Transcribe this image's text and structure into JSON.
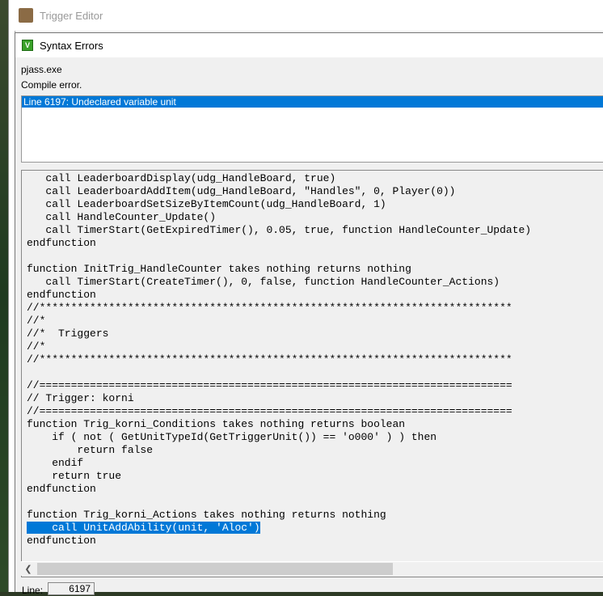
{
  "parent_window": {
    "title": "Trigger Editor"
  },
  "dialog": {
    "title": "Syntax Errors",
    "tool": "pjass.exe",
    "status": "Compile error.",
    "errors": [
      "Line 6197:  Undeclared variable unit"
    ],
    "selected_error": 0,
    "code_lines": [
      "   call LeaderboardDisplay(udg_HandleBoard, true)",
      "   call LeaderboardAddItem(udg_HandleBoard, \"Handles\", 0, Player(0))",
      "   call LeaderboardSetSizeByItemCount(udg_HandleBoard, 1)",
      "   call HandleCounter_Update()",
      "   call TimerStart(GetExpiredTimer(), 0.05, true, function HandleCounter_Update)",
      "endfunction",
      "",
      "function InitTrig_HandleCounter takes nothing returns nothing",
      "   call TimerStart(CreateTimer(), 0, false, function HandleCounter_Actions)",
      "endfunction",
      "//***************************************************************************",
      "//*",
      "//*  Triggers",
      "//*",
      "//***************************************************************************",
      "",
      "//===========================================================================",
      "// Trigger: korni",
      "//===========================================================================",
      "function Trig_korni_Conditions takes nothing returns boolean",
      "    if ( not ( GetUnitTypeId(GetTriggerUnit()) == 'o000' ) ) then",
      "        return false",
      "    endif",
      "    return true",
      "endfunction",
      "",
      "function Trig_korni_Actions takes nothing returns nothing",
      "    call UnitAddAbility(unit, 'Aloc')",
      "endfunction"
    ],
    "highlighted_line": 27,
    "line_label": "Line:",
    "line_value": "6197"
  }
}
